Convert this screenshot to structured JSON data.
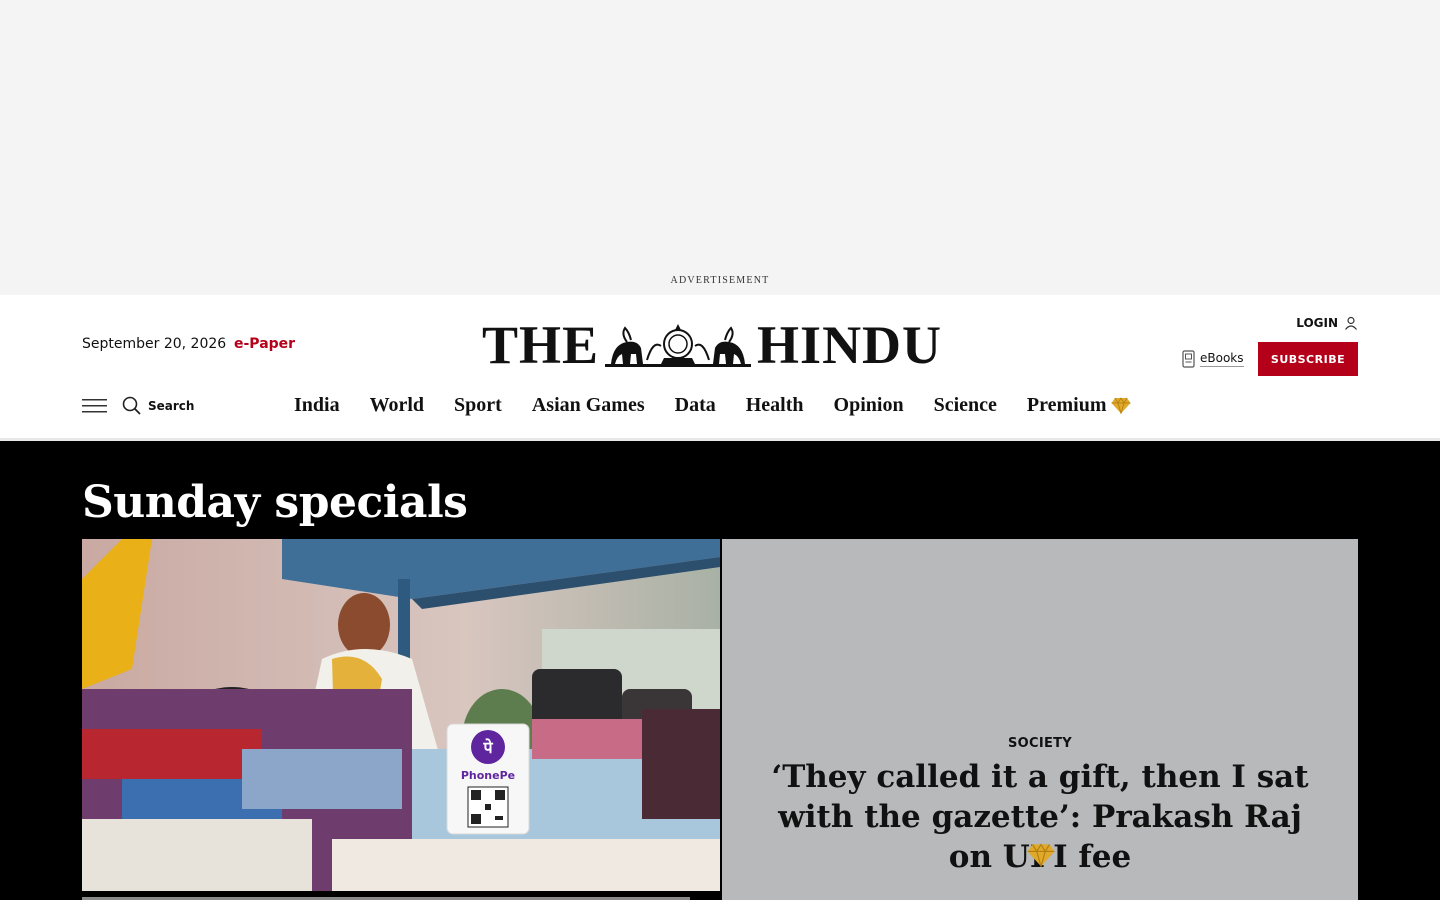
{
  "ad": {
    "label": "ADVERTISEMENT"
  },
  "header": {
    "date": "September 20, 2026",
    "epaper": "e-Paper",
    "logo_left": "THE",
    "logo_right": "HINDU",
    "login": "LOGIN",
    "ebooks": "eBooks",
    "subscribe": "SUBSCRIBE",
    "search": "Search"
  },
  "nav": {
    "items": [
      "India",
      "World",
      "Sport",
      "Asian Games",
      "Data",
      "Health",
      "Opinion",
      "Science",
      "Premium"
    ]
  },
  "section": {
    "title": "Sunday specials",
    "featured": {
      "kicker": "SOCIETY",
      "headline": "‘They called it a gift, then I sat with the gazette’: Prakash Raj on UPI fee",
      "qr_brand": "PhonePe"
    }
  },
  "colors": {
    "accent": "#b5001a",
    "premium_gem": "#e0a92a",
    "section_bg": "#000000",
    "card_bg": "#b7b9ba"
  },
  "icons": [
    "hamburger-menu-icon",
    "search-icon",
    "user-icon",
    "ebook-icon",
    "premium-gem-icon"
  ]
}
